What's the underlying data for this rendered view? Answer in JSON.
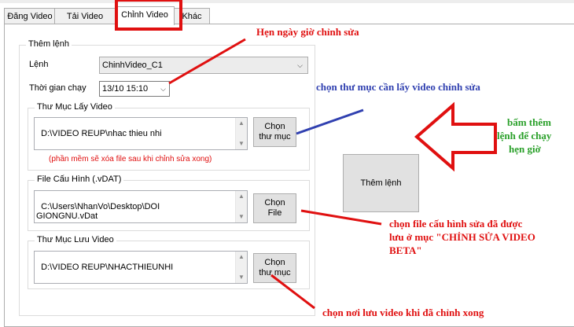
{
  "tabs": [
    {
      "label": "Đăng Video"
    },
    {
      "label": "Tải Video"
    },
    {
      "label": "Chỉnh Video"
    },
    {
      "label": "Khác"
    }
  ],
  "them_lenh_group": {
    "title": "Thêm lệnh",
    "lenh_label": "Lệnh",
    "lenh_value": "ChinhVideo_C1",
    "thoigian_label": "Thời gian chạy",
    "thoigian_value": "13/10 15:10"
  },
  "thu_muc_lay_video": {
    "title": "Thư Mục Lấy Video",
    "path": "D:\\VIDEO REUP\\nhac thieu nhi",
    "button": "Chọn\nthư mục",
    "note": "(phần mềm sẽ xóa file sau khi chỉnh sửa xong)"
  },
  "file_cau_hinh": {
    "title": "File Cấu Hình (.vDAT)",
    "path": "C:\\Users\\NhanVo\\Desktop\\DOI\nGIONGNU.vDat",
    "button": "Chọn\nFile"
  },
  "thu_muc_luu_video": {
    "title": "Thư Mục Lưu Video",
    "path": "D:\\VIDEO REUP\\NHACTHIEUNHI",
    "button": "Chọn\nthư mục"
  },
  "them_lenh_button": "Thêm lệnh",
  "annotations": {
    "hen_ngay": "Hẹn ngày  giờ chỉnh sửa",
    "chon_thu_muc": "chọn thư mục cần lấy video chỉnh sửa",
    "bam_them_1": "bấm thêm",
    "bam_them_2": "lệnh để chạy",
    "bam_them_3": "hẹn giờ",
    "chon_file_1": "chọn file cấu hình sửa đã được",
    "chon_file_2": "lưu ở mục \"CHỈNH SỬA VIDEO",
    "chon_file_3": "BETA\"",
    "chon_noi_luu": "chọn nơi lưu video khi đã chỉnh xong"
  },
  "colors": {
    "annotation_red": "#e01010",
    "annotation_blue": "#3040b0",
    "annotation_green": "#2aa02a"
  }
}
